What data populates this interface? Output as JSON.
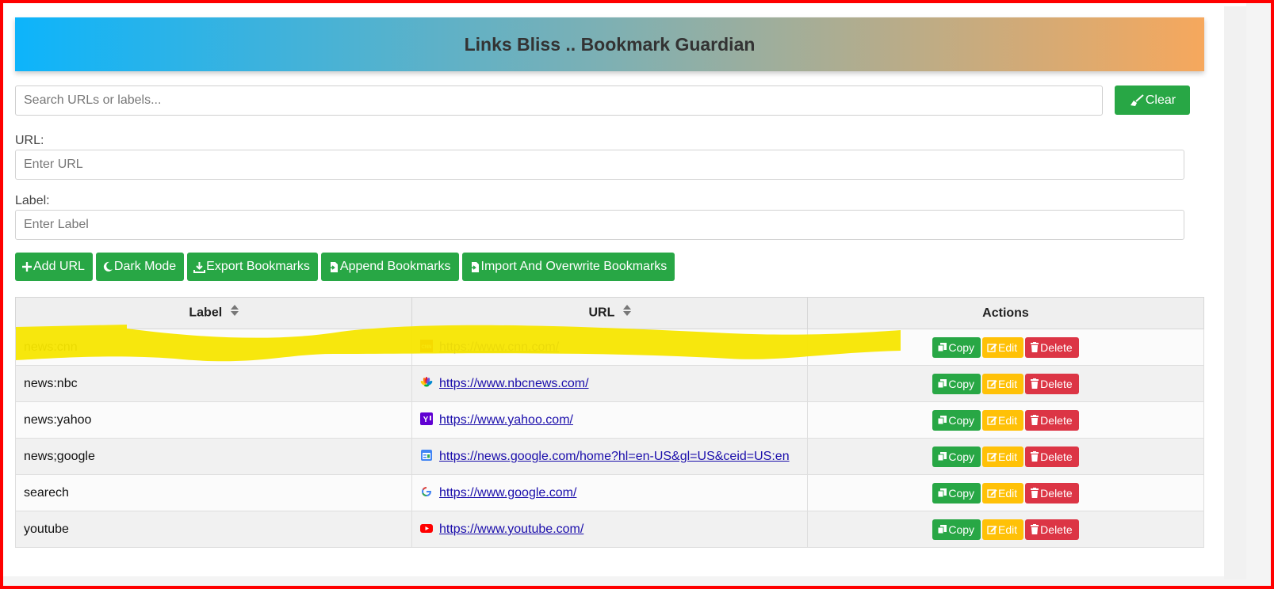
{
  "app": {
    "title": "Links Bliss .. Bookmark Guardian"
  },
  "search": {
    "placeholder": "Search URLs or labels...",
    "value": "",
    "clear_label": "Clear"
  },
  "form": {
    "url_label": "URL:",
    "url_placeholder": "Enter URL",
    "label_label": "Label:",
    "label_placeholder": "Enter Label"
  },
  "toolbar": {
    "add_url": "Add URL",
    "dark_mode": "Dark Mode",
    "export": "Export Bookmarks",
    "append": "Append Bookmarks",
    "import_overwrite": "Import And Overwrite Bookmarks"
  },
  "table": {
    "headers": {
      "label": "Label",
      "url": "URL",
      "actions": "Actions"
    },
    "rows": [
      {
        "label": "news:cnn",
        "url": "https://www.cnn.com/",
        "favicon": "cnn-favicon-icon"
      },
      {
        "label": "news:nbc",
        "url": "https://www.nbcnews.com/",
        "favicon": "nbc-favicon-icon"
      },
      {
        "label": "news:yahoo",
        "url": "https://www.yahoo.com/",
        "favicon": "yahoo-favicon-icon"
      },
      {
        "label": "news;google",
        "url": "https://news.google.com/home?hl=en-US&gl=US&ceid=US:en",
        "favicon": "google-news-favicon-icon"
      },
      {
        "label": "searech",
        "url": "https://www.google.com/",
        "favicon": "google-favicon-icon"
      },
      {
        "label": "youtube",
        "url": "https://www.youtube.com/",
        "favicon": "youtube-favicon-icon"
      }
    ],
    "actions": {
      "copy": "Copy",
      "edit": "Edit",
      "delete": "Delete"
    }
  },
  "colors": {
    "green": "#28a745",
    "yellow": "#ffc107",
    "red": "#dc3545",
    "highlight": "#f7e600",
    "frame": "#ff0000"
  }
}
